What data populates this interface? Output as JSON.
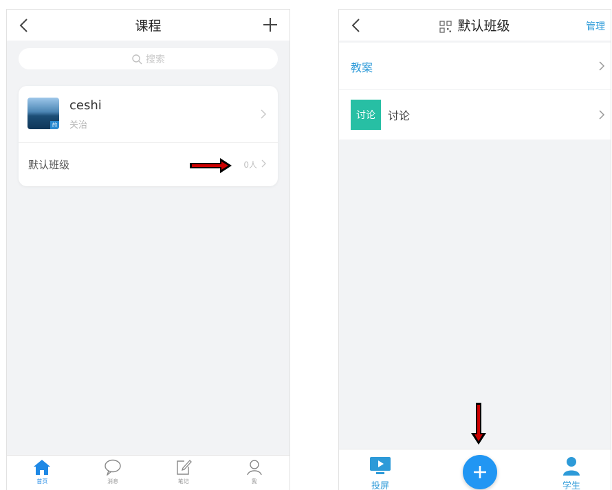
{
  "left_screen": {
    "header": {
      "title": "课程"
    },
    "search": {
      "placeholder": "搜索"
    },
    "course": {
      "name": "ceshi",
      "teacher": "关治",
      "thumb_badge": "的"
    },
    "class_row": {
      "name": "默认班级",
      "count": "0人"
    },
    "tabbar": {
      "items": [
        {
          "label": "首页",
          "icon": "home-icon",
          "active": true
        },
        {
          "label": "消息",
          "icon": "message-icon",
          "active": false
        },
        {
          "label": "笔记",
          "icon": "note-icon",
          "active": false
        },
        {
          "label": "我",
          "icon": "profile-icon",
          "active": false
        }
      ]
    }
  },
  "right_screen": {
    "header": {
      "title": "默认班级",
      "manage": "管理"
    },
    "rows": [
      {
        "label": "教案"
      },
      {
        "icon_text": "讨论",
        "label": "讨论"
      }
    ],
    "tabbar": {
      "left": {
        "label": "投屏",
        "icon": "screen-cast-icon"
      },
      "center": {
        "icon": "add-icon"
      },
      "right": {
        "label": "学生",
        "icon": "student-icon"
      }
    }
  },
  "colors": {
    "accent": "#2d9ad8",
    "fab": "#2196f3",
    "discussion": "#27bfa4",
    "annotation_arrow": "#cc0000"
  }
}
